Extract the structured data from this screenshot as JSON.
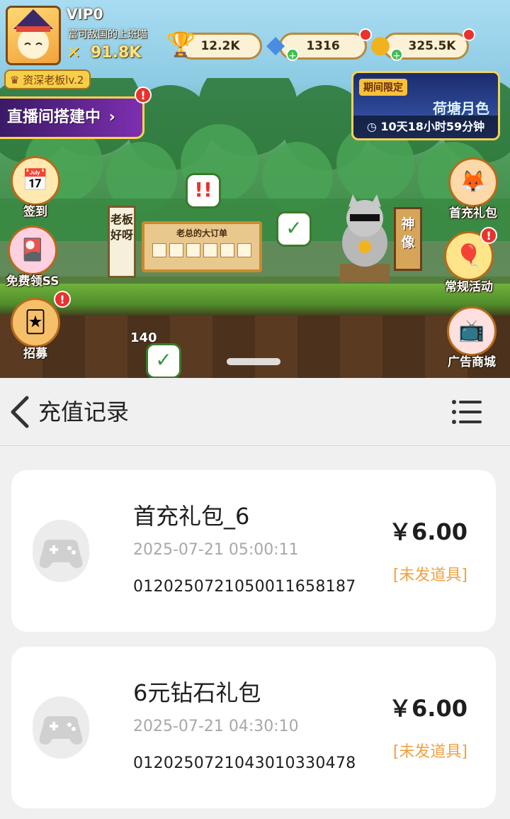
{
  "game": {
    "vip_label": "VIP0",
    "nickname": "富可敌国的上班喵",
    "power": "91.8K",
    "rank": "资深老板lv.2",
    "currencies": {
      "trophy": "12.2K",
      "diamond": "1316",
      "coin": "325.5K"
    },
    "live_banner": "直播间搭建中",
    "event": {
      "tag": "期间限定",
      "title": "荷塘月色",
      "timer": "10天18小时59分钟"
    },
    "left_buttons": [
      "签到",
      "免费领SS",
      "招募"
    ],
    "right_buttons": [
      "首充礼包",
      "常规活动",
      "广告商城"
    ],
    "order_board_title": "老总的大订单",
    "sign_left": "老板好呀",
    "sign_right": "神像",
    "counter": "140",
    "colors": {
      "badge_red": "#e8322d",
      "gold": "#f7cf4a",
      "grass": "#4f9a58"
    }
  },
  "titlebar": {
    "back_icon": "chevron-left-icon",
    "title": "充值记录",
    "menu_icon": "hamburger-menu-icon"
  },
  "records": [
    {
      "name": "首充礼包_6",
      "time": "2025-07-21 05:00:11",
      "order_id": "0120250721050011658187",
      "amount": "￥6.00",
      "status": "[未发道具]"
    },
    {
      "name": "6元钻石礼包",
      "time": "2025-07-21 04:30:10",
      "order_id": "0120250721043010330478",
      "amount": "￥6.00",
      "status": "[未发道具]"
    }
  ],
  "colors": {
    "status_orange": "#f0a040",
    "background": "#f0f0f0",
    "card": "#ffffff"
  }
}
